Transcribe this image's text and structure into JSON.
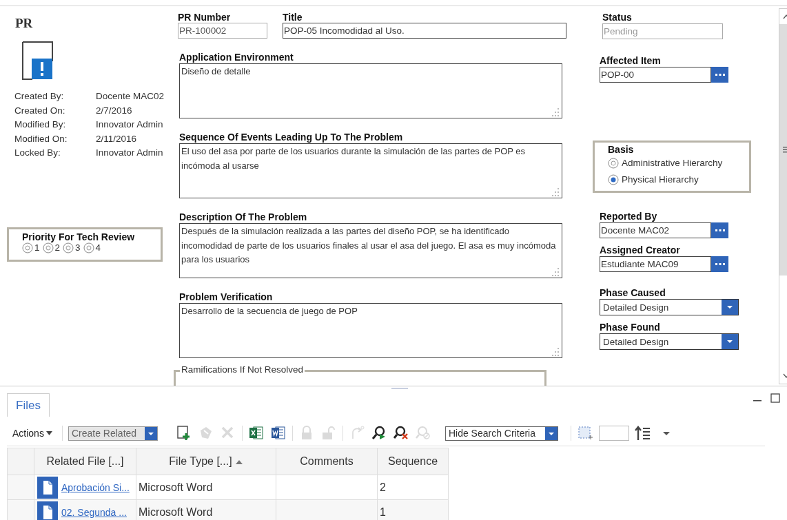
{
  "record": {
    "type_label": "PR",
    "meta": [
      {
        "label": "Created By:",
        "value": "Docente MAC02"
      },
      {
        "label": "Created On:",
        "value": "2/7/2016"
      },
      {
        "label": "Modified By:",
        "value": "Innovator Admin"
      },
      {
        "label": "Modified On:",
        "value": "2/11/2016"
      },
      {
        "label": "Locked By:",
        "value": "Innovator Admin"
      }
    ]
  },
  "priority": {
    "title": "Priority For Tech Review",
    "options": [
      {
        "label": "1",
        "selected": false
      },
      {
        "label": "2",
        "selected": false
      },
      {
        "label": "3",
        "selected": false
      },
      {
        "label": "4",
        "selected": false
      }
    ]
  },
  "header_fields": [
    {
      "label": "PR Number",
      "value": "PR-100002",
      "readonly": true
    },
    {
      "label": "Title",
      "value": "POP-05 Incomodidad al Uso.",
      "readonly": false
    }
  ],
  "text_areas": [
    {
      "label": "Application Environment",
      "value": "Diseño de detalle"
    },
    {
      "label": "Sequence Of Events Leading Up To The Problem",
      "value": "El uso del asa por parte de los usuarios durante la simulación de las partes de POP es incómoda al usarse"
    },
    {
      "label": "Description Of The Problem",
      "value": "Después de la simulación realizada a las partes del diseño POP, se ha identificado incomodidad de parte de los usuarios finales al usar el asa del juego. El asa es muy incómoda para los usuarios"
    },
    {
      "label": "Problem Verification",
      "value": "Desarrollo de la secuencia de juego de POP"
    }
  ],
  "ramifications": {
    "label": "Ramifications If Not Resolved"
  },
  "right_fields": [
    {
      "kind": "readonly",
      "label": "Status",
      "value": "Pending"
    },
    {
      "kind": "item",
      "label": "Affected Item",
      "value": "POP-00"
    },
    {
      "kind": "radio_group",
      "label": "Basis",
      "options": [
        {
          "label": "Administrative Hierarchy",
          "selected": false
        },
        {
          "label": "Physical Hierarchy",
          "selected": true
        }
      ]
    },
    {
      "kind": "item",
      "label": "Reported By",
      "value": "Docente  MAC02"
    },
    {
      "kind": "item",
      "label": "Assigned Creator",
      "value": "Estudiante  MAC09"
    },
    {
      "kind": "select",
      "label": "Phase Caused",
      "value": "Detailed Design"
    },
    {
      "kind": "select",
      "label": "Phase Found",
      "value": "Detailed Design"
    }
  ],
  "files_panel": {
    "tabs": [
      {
        "label": "Files",
        "selected": true
      }
    ],
    "toolbar": {
      "actions": "Actions",
      "create_related": "Create Related",
      "search_mode": "Hide Search Criteria",
      "tools": [
        {
          "kind": "add",
          "disabled": false
        },
        {
          "kind": "pick",
          "disabled": true
        },
        {
          "kind": "delete",
          "disabled": true
        },
        {
          "kind": "excel",
          "disabled": false
        },
        {
          "kind": "word",
          "disabled": false
        },
        {
          "kind": "lock",
          "disabled": true
        },
        {
          "kind": "unlock",
          "disabled": true
        },
        {
          "kind": "rotate",
          "disabled": true
        },
        {
          "kind": "run_search",
          "disabled": false
        },
        {
          "kind": "clear_search",
          "disabled": false
        },
        {
          "kind": "saved_search",
          "disabled": true
        }
      ]
    },
    "table": {
      "columns": [
        {
          "label": "Related File [...]"
        },
        {
          "label": "File Type [...]",
          "sort_ascending": true
        },
        {
          "label": "Comments"
        },
        {
          "label": "Sequence"
        }
      ],
      "rows": [
        {
          "related_file": "Aprobación Si...",
          "file_type": "Microsoft Word",
          "sequence": "2"
        },
        {
          "related_file": "02. Segunda ...",
          "file_type": "Microsoft Word",
          "sequence": "1"
        }
      ]
    }
  }
}
